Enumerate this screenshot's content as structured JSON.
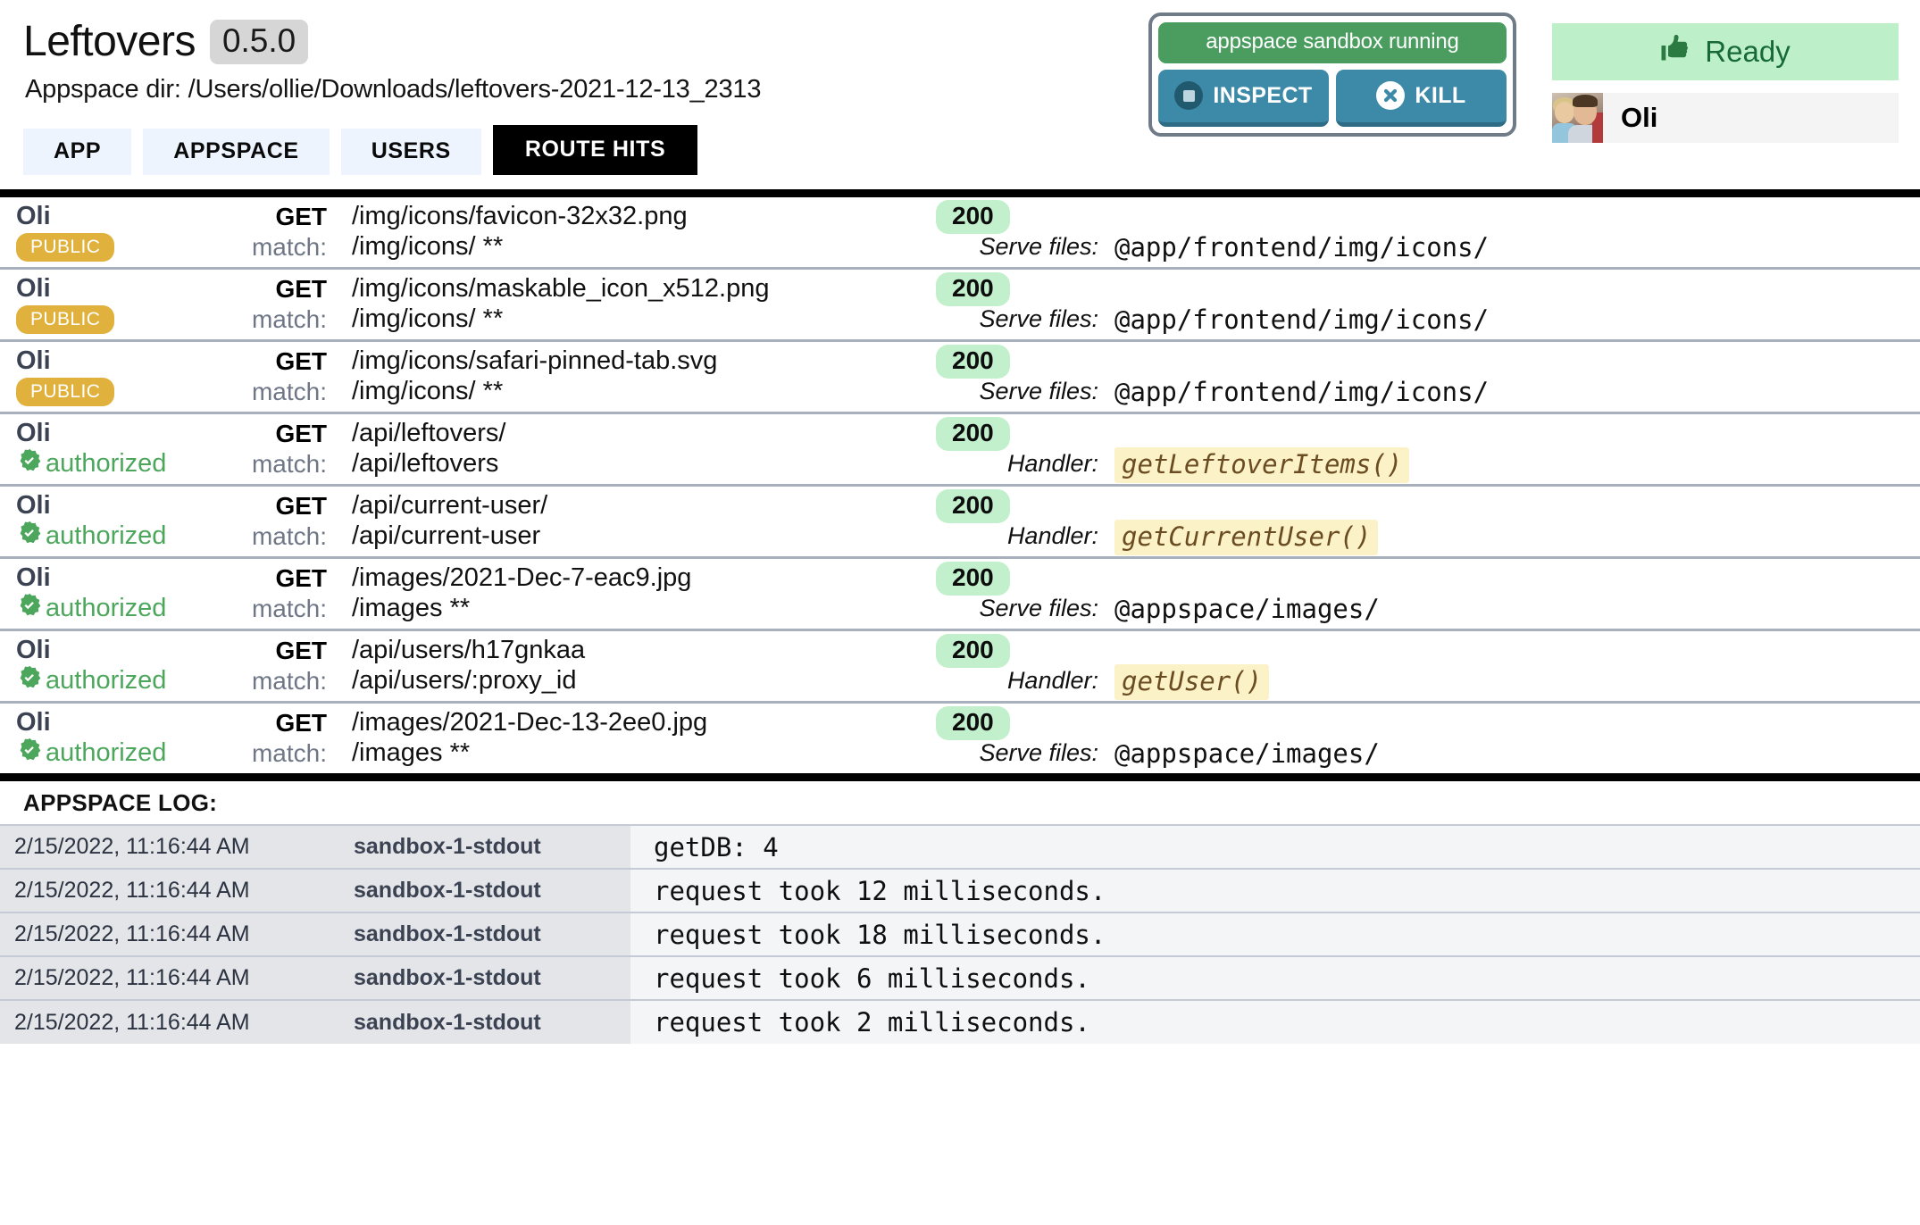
{
  "header": {
    "app_title": "Leftovers",
    "version": "0.5.0",
    "appspace_dir_label": "Appspace dir:",
    "appspace_dir_path": "/Users/ollie/Downloads/leftovers-2021-12-13_2313",
    "tabs": [
      {
        "label": "APP",
        "active": false
      },
      {
        "label": "APPSPACE",
        "active": false
      },
      {
        "label": "USERS",
        "active": false
      },
      {
        "label": "ROUTE HITS",
        "active": true
      }
    ],
    "sandbox": {
      "status_label": "appspace sandbox running",
      "inspect_label": "INSPECT",
      "kill_label": "KILL",
      "inspect_icon": "stop-circle-icon",
      "kill_icon": "x-circle-icon",
      "status_color": "#4a9d5f",
      "button_color": "#3d8aa8"
    },
    "ready": {
      "label": "Ready",
      "icon": "thumbs-up-icon",
      "bg_color": "#bdf0c8",
      "text_color": "#18693a"
    },
    "user": {
      "name": "Oli",
      "avatar": "user-photo-avatar"
    }
  },
  "route_hits": {
    "labels": {
      "match": "match:",
      "serve_files": "Serve files:",
      "handler": "Handler:"
    },
    "rows": [
      {
        "user": "Oli",
        "auth_type": "public",
        "auth_label": "PUBLIC",
        "method": "GET",
        "path": "/img/icons/favicon-32x32.png",
        "status": "200",
        "match": "/img/icons/ **",
        "target_label": "Serve files:",
        "target": "@app/frontend/img/icons/",
        "target_kind": "files"
      },
      {
        "user": "Oli",
        "auth_type": "public",
        "auth_label": "PUBLIC",
        "method": "GET",
        "path": "/img/icons/maskable_icon_x512.png",
        "status": "200",
        "match": "/img/icons/ **",
        "target_label": "Serve files:",
        "target": "@app/frontend/img/icons/",
        "target_kind": "files"
      },
      {
        "user": "Oli",
        "auth_type": "public",
        "auth_label": "PUBLIC",
        "method": "GET",
        "path": "/img/icons/safari-pinned-tab.svg",
        "status": "200",
        "match": "/img/icons/ **",
        "target_label": "Serve files:",
        "target": "@app/frontend/img/icons/",
        "target_kind": "files"
      },
      {
        "user": "Oli",
        "auth_type": "authorized",
        "auth_label": "authorized",
        "method": "GET",
        "path": "/api/leftovers/",
        "status": "200",
        "match": "/api/leftovers",
        "target_label": "Handler:",
        "target": "getLeftoverItems()",
        "target_kind": "handler"
      },
      {
        "user": "Oli",
        "auth_type": "authorized",
        "auth_label": "authorized",
        "method": "GET",
        "path": "/api/current-user/",
        "status": "200",
        "match": "/api/current-user",
        "target_label": "Handler:",
        "target": "getCurrentUser()",
        "target_kind": "handler"
      },
      {
        "user": "Oli",
        "auth_type": "authorized",
        "auth_label": "authorized",
        "method": "GET",
        "path": "/images/2021-Dec-7-eac9.jpg",
        "status": "200",
        "match": "/images **",
        "target_label": "Serve files:",
        "target": "@appspace/images/",
        "target_kind": "files"
      },
      {
        "user": "Oli",
        "auth_type": "authorized",
        "auth_label": "authorized",
        "method": "GET",
        "path": "/api/users/h17gnkaa",
        "status": "200",
        "match": "/api/users/:proxy_id",
        "target_label": "Handler:",
        "target": "getUser()",
        "target_kind": "handler"
      },
      {
        "user": "Oli",
        "auth_type": "authorized",
        "auth_label": "authorized",
        "method": "GET",
        "path": "/images/2021-Dec-13-2ee0.jpg",
        "status": "200",
        "match": "/images **",
        "target_label": "Serve files:",
        "target": "@appspace/images/",
        "target_kind": "files"
      }
    ]
  },
  "appspace_log": {
    "title": "APPSPACE LOG:",
    "entries": [
      {
        "time": "2/15/2022, 11:16:44 AM",
        "source": "sandbox-1-stdout",
        "message": "getDB: 4"
      },
      {
        "time": "2/15/2022, 11:16:44 AM",
        "source": "sandbox-1-stdout",
        "message": "request took 12 milliseconds."
      },
      {
        "time": "2/15/2022, 11:16:44 AM",
        "source": "sandbox-1-stdout",
        "message": "request took 18 milliseconds."
      },
      {
        "time": "2/15/2022, 11:16:44 AM",
        "source": "sandbox-1-stdout",
        "message": "request took 6 milliseconds."
      },
      {
        "time": "2/15/2022, 11:16:44 AM",
        "source": "sandbox-1-stdout",
        "message": "request took 2 milliseconds."
      }
    ]
  },
  "colors": {
    "status_200_bg": "#c2f0cd",
    "public_badge_bg": "#e0b13c",
    "authorized_green": "#4ca75c",
    "handler_highlight": "#fbf3c7",
    "tab_bg": "#eef4fd",
    "active_tab_bg": "#000000"
  }
}
